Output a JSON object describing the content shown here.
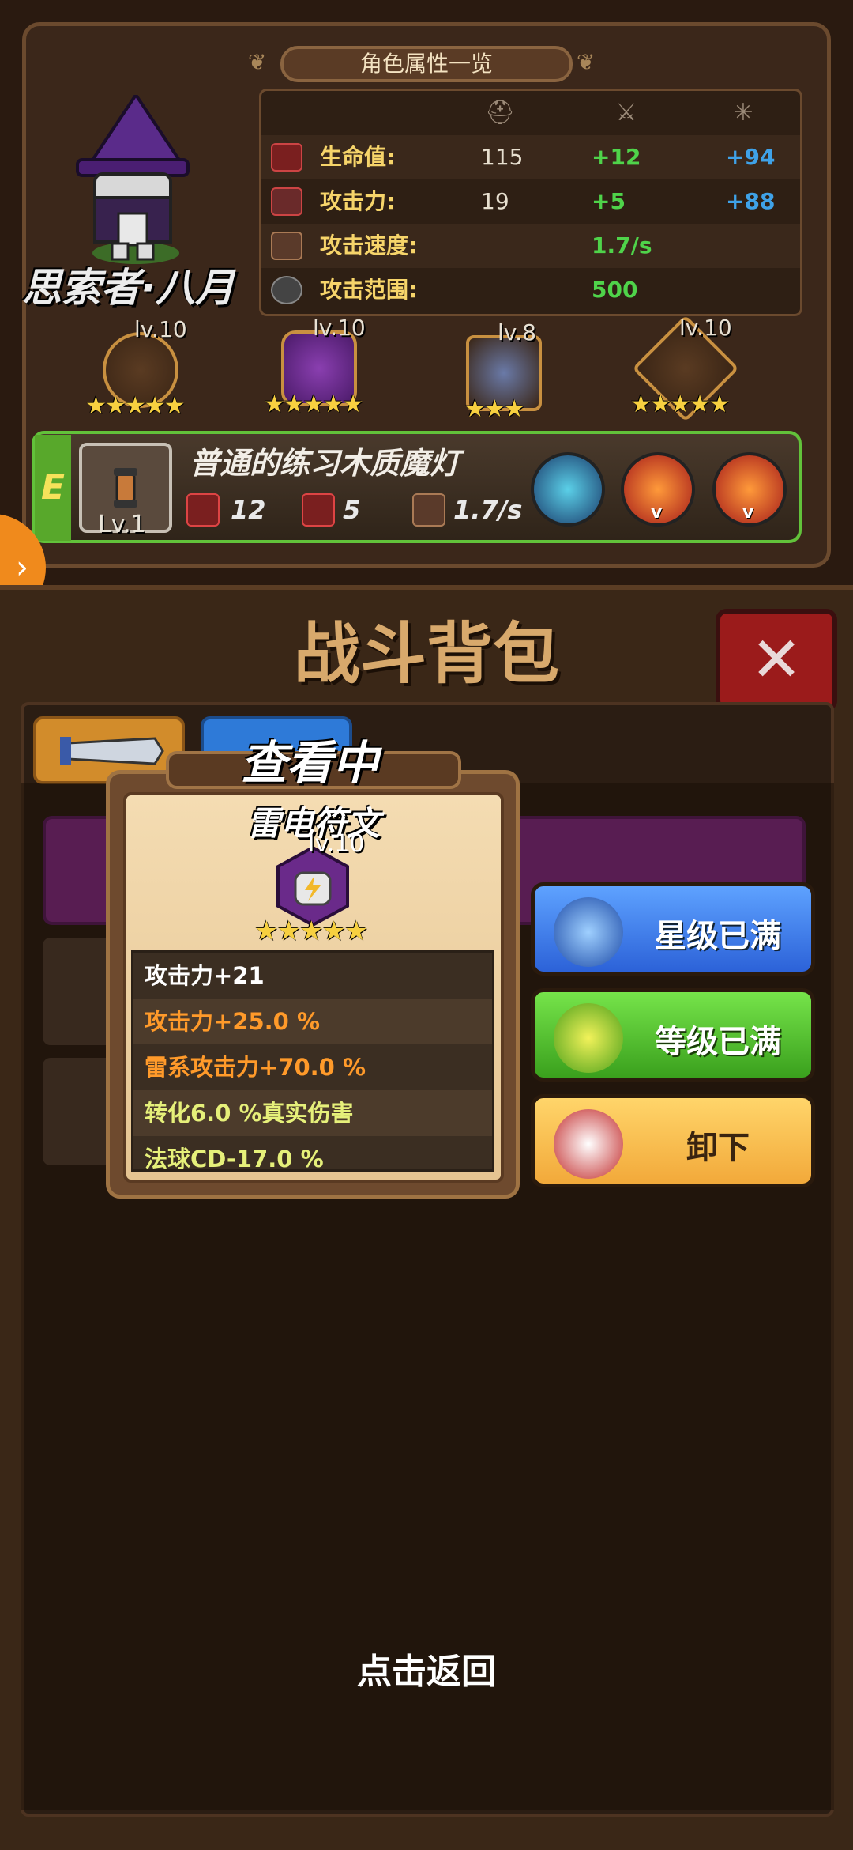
{
  "panel": {
    "title": "角色属性一览",
    "character_name": "思索者·八月",
    "columns": [
      "helmet-icon",
      "sword-icon",
      "spark-icon"
    ],
    "stats": [
      {
        "label": "生命值:",
        "base": "115",
        "bonus_green": "+12",
        "bonus_blue": "+94",
        "icon": "heart-icon"
      },
      {
        "label": "攻击力:",
        "base": "19",
        "bonus_green": "+5",
        "bonus_blue": "+88",
        "icon": "sword-icon"
      },
      {
        "label": "攻击速度:",
        "base": "",
        "bonus_green": "1.7/s",
        "bonus_blue": "",
        "icon": "speed-sword-icon"
      },
      {
        "label": "攻击范围:",
        "base": "",
        "bonus_green": "500",
        "bonus_blue": "",
        "icon": "crosshair-icon"
      }
    ],
    "equipment": [
      {
        "name": "crown-ring",
        "level": "lv.10",
        "stars": "★★★★★"
      },
      {
        "name": "lightning-rune",
        "level": "lv.10",
        "stars": "★★★★★"
      },
      {
        "name": "shield-amulet",
        "level": "lv.8",
        "stars": "★★★"
      },
      {
        "name": "boots",
        "level": "lv.10",
        "stars": "★★★★★"
      }
    ],
    "weapon": {
      "rank": "E",
      "level": "Lv.1",
      "name": "普通的练习木质魔灯",
      "hp": "12",
      "attack": "5",
      "speed": "1.7/s"
    }
  },
  "bag": {
    "title": "战斗背包",
    "close": "✕"
  },
  "card": {
    "viewing": "查看中",
    "item_name": "雷电符文",
    "level": "lv.10",
    "stars": "★★★★★",
    "attributes": [
      {
        "text": "攻击力+21",
        "color": "#ffffff"
      },
      {
        "text": "攻击力+25.0 %",
        "color": "#ff9a2a"
      },
      {
        "text": "雷系攻击力+70.0 %",
        "color": "#ff9a2a"
      },
      {
        "text": "转化6.0 %真实伤害",
        "color": "#e6f07a"
      },
      {
        "text": "法球CD-17.0 %",
        "color": "#e6f07a"
      }
    ]
  },
  "actions": {
    "star_label": "星级已满",
    "level_label": "等级已满",
    "unequip_label": "卸下"
  },
  "footer": {
    "back_hint": "点击返回"
  }
}
